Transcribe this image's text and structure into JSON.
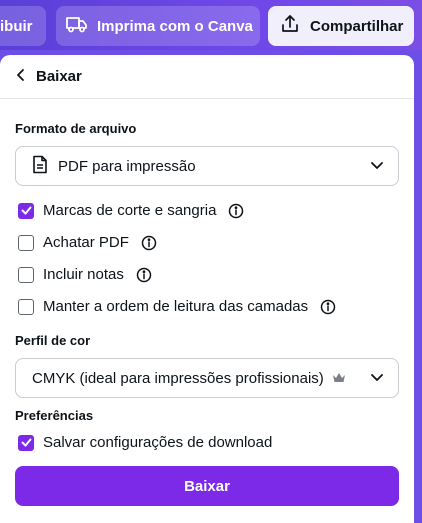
{
  "topbar": {
    "left_button_label": "ibuir",
    "canva_print_label": "Imprima com o Canva",
    "share_label": "Compartilhar"
  },
  "panel": {
    "back_label": "Baixar",
    "file_format_label": "Formato de arquivo",
    "file_format_value": "PDF para impressão",
    "options": [
      {
        "label": "Marcas de corte e sangria",
        "checked": true,
        "info": true
      },
      {
        "label": "Achatar PDF",
        "checked": false,
        "info": true
      },
      {
        "label": "Incluir notas",
        "checked": false,
        "info": true
      },
      {
        "label": "Manter a ordem de leitura das camadas",
        "checked": false,
        "info": true
      }
    ],
    "color_profile_label": "Perfil de cor",
    "color_profile_value": "CMYK (ideal para impressões profissionais)",
    "preferences_label": "Preferências",
    "save_settings_label": "Salvar configurações de download",
    "save_settings_checked": true,
    "download_button_label": "Baixar"
  },
  "colors": {
    "accent": "#7d2ae8",
    "topbar": "#6d4ee6"
  }
}
